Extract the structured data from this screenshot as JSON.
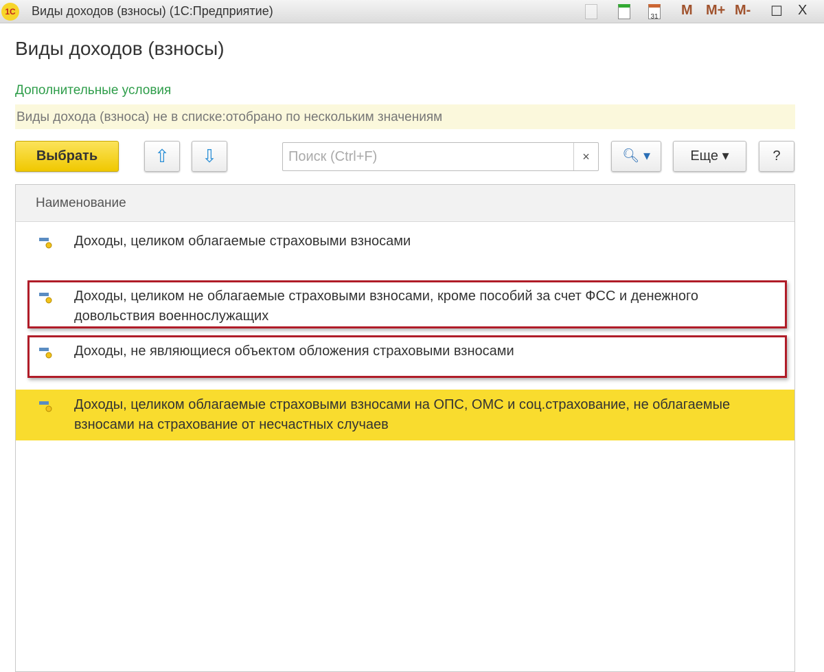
{
  "window": {
    "logo": "1С",
    "title": "Виды доходов (взносы)  (1С:Предприятие)",
    "calendar_day": "31",
    "m": "M",
    "m_plus": "M+",
    "m_minus": "M-",
    "maximize": "☐",
    "close": "X"
  },
  "page": {
    "title": "Виды доходов (взносы)",
    "additional_conditions": "Дополнительные условия",
    "filter_text": "Виды дохода (взноса) не в списке:отобрано по нескольким значениям"
  },
  "toolbar": {
    "select": "Выбрать",
    "up": "⇧",
    "down": "⇩",
    "search_placeholder": "Поиск (Ctrl+F)",
    "clear": "×",
    "search_icon": "🔍︎ ▾",
    "more": "Еще ▾",
    "help": "?"
  },
  "table": {
    "column": "Наименование",
    "rows": [
      {
        "text": "Доходы, целиком облагаемые страховыми взносами",
        "selected": false
      },
      {
        "text": "Доходы, целиком не облагаемые страховыми взносами, кроме пособий за счет ФСС и денежного довольствия военнослужащих",
        "selected": false
      },
      {
        "text": "Доходы, не являющиеся объектом обложения страховыми взносами",
        "selected": false
      },
      {
        "text": "Доходы, целиком облагаемые страховыми взносами на ОПС, ОМС и соц.страхование, не облагаемые взносами на страхование от несчастных случаев",
        "selected": true
      }
    ]
  },
  "colors": {
    "accent": "#f9dc2e",
    "highlight": "#b01c28",
    "link": "#2e9d4a"
  }
}
